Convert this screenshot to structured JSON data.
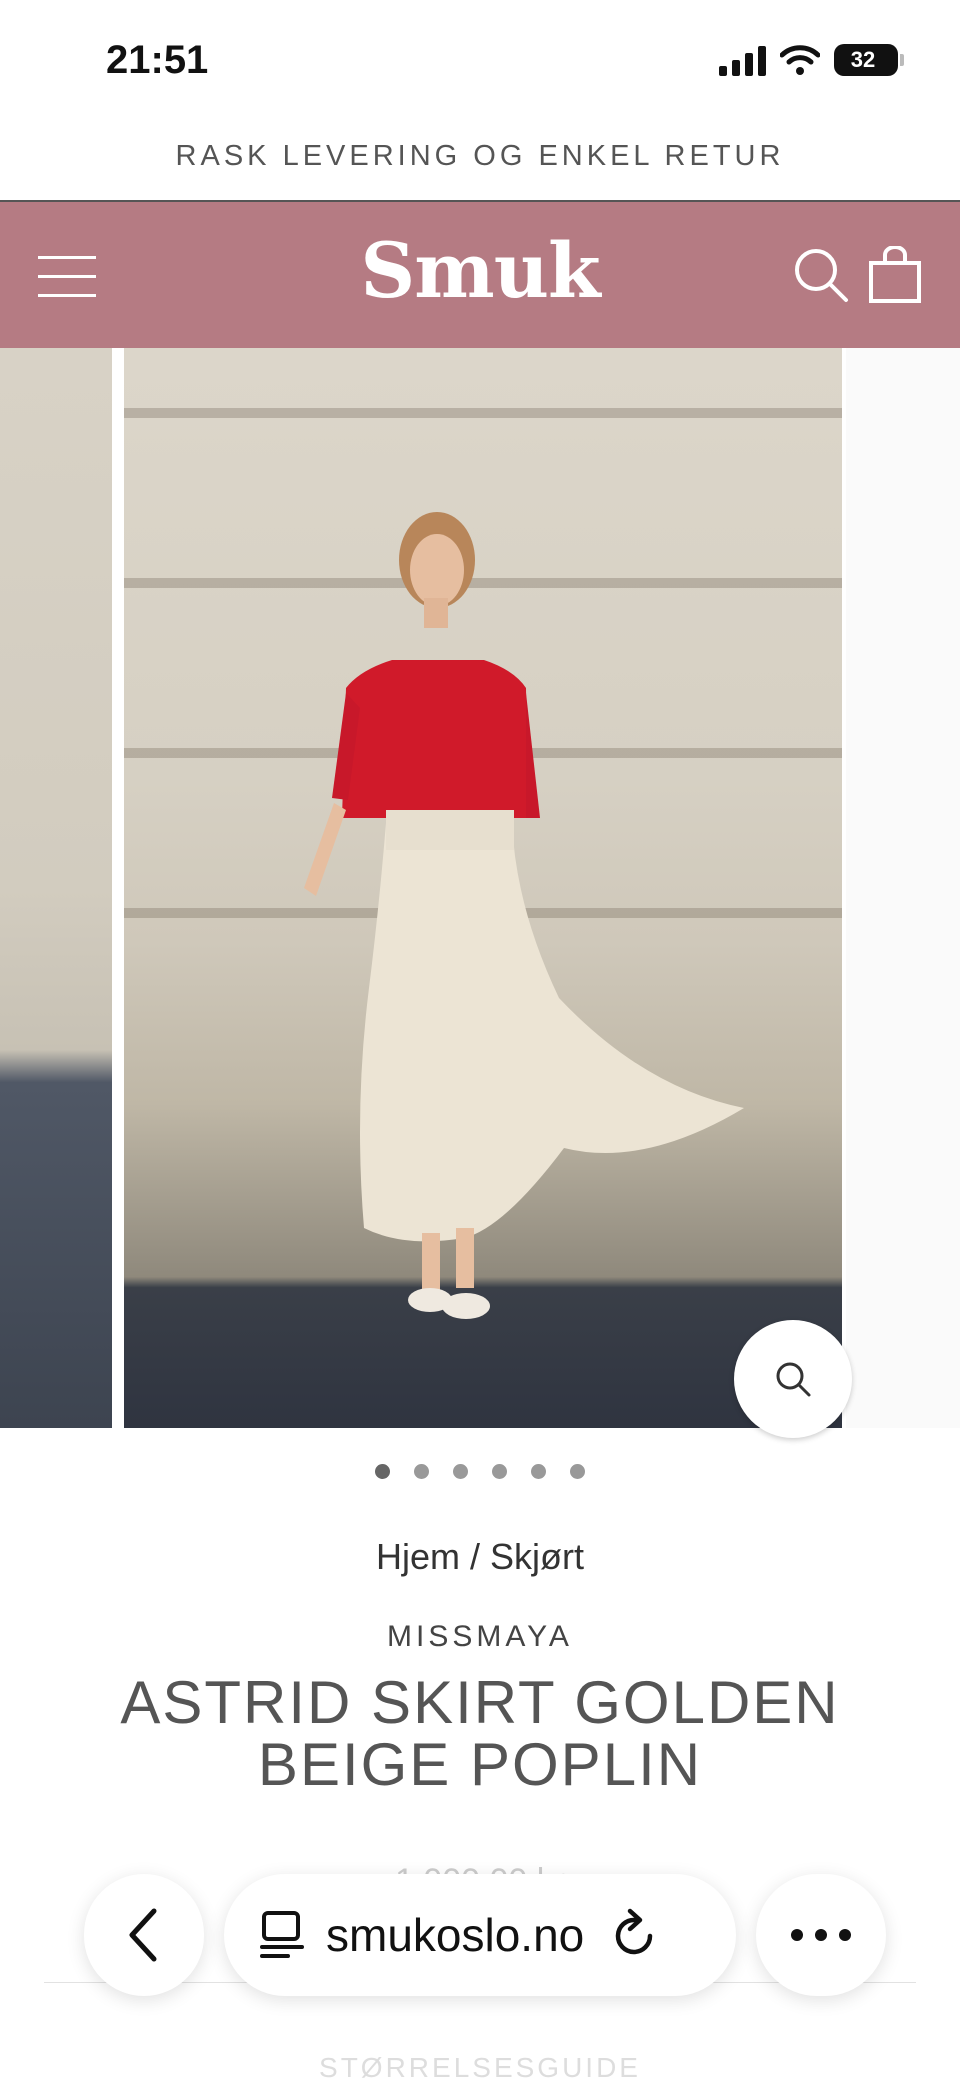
{
  "status_bar": {
    "time": "21:51",
    "battery": "32"
  },
  "promo": {
    "text": "RASK LEVERING OG ENKEL RETUR"
  },
  "header": {
    "logo": "Smuk",
    "accent_color": "#b57b83"
  },
  "gallery": {
    "dot_count": 6,
    "active_dot": 0
  },
  "breadcrumb": {
    "text": "Hjem / Skjørt"
  },
  "product": {
    "brand": "MISSMAYA",
    "title": "ASTRID SKIRT GOLDEN BEIGE POPLIN",
    "price": "1 000,00 kr",
    "size_guide": "STØRRELSESGUIDE"
  },
  "browser": {
    "url": "smukoslo.no"
  },
  "icons": [
    "menu-icon",
    "search-icon",
    "bag-icon",
    "zoom-icon",
    "back-icon",
    "tabs-icon",
    "reload-icon",
    "more-icon"
  ]
}
